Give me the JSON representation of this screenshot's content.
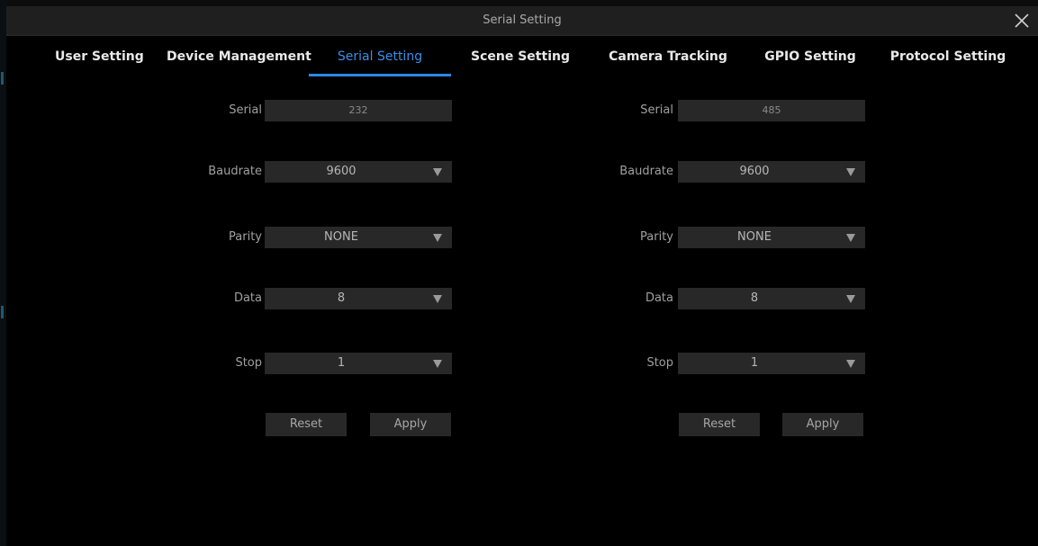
{
  "window": {
    "title": "Serial Setting"
  },
  "tabs": [
    {
      "label": "User Setting"
    },
    {
      "label": "Device Management"
    },
    {
      "label": "Serial Setting"
    },
    {
      "label": "Scene Setting"
    },
    {
      "label": "Camera Tracking"
    },
    {
      "label": "GPIO Setting"
    },
    {
      "label": "Protocol Setting"
    }
  ],
  "active_tab": "Serial Setting",
  "labels": {
    "serial": "Serial",
    "baudrate": "Baudrate",
    "parity": "Parity",
    "data": "Data",
    "stop": "Stop"
  },
  "panels": [
    {
      "serial": "232",
      "baudrate": "9600",
      "parity": "NONE",
      "data": "8",
      "stop": "1",
      "reset": "Reset",
      "apply": "Apply"
    },
    {
      "serial": "485",
      "baudrate": "9600",
      "parity": "NONE",
      "data": "8",
      "stop": "1",
      "reset": "Reset",
      "apply": "Apply"
    }
  ],
  "colors": {
    "accent": "#2e86e6",
    "field_bg": "#282828",
    "background": "#000000"
  },
  "icons": {
    "close": "close-icon",
    "dropdown": "chevron-down-icon"
  }
}
